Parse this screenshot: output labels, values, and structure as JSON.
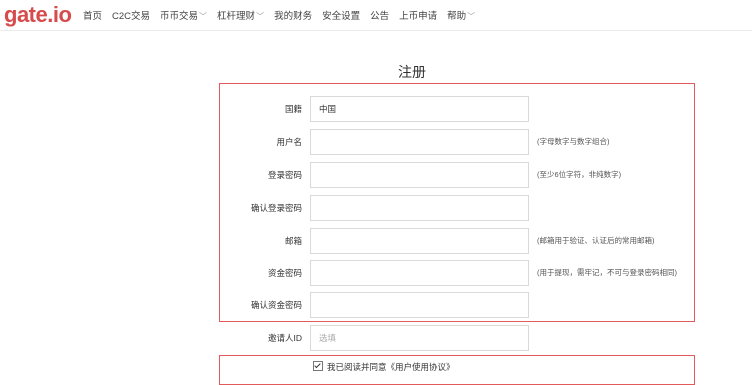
{
  "brand": {
    "gate": "gate",
    "dot": ".",
    "io": "io"
  },
  "nav": [
    {
      "label": "首页",
      "dropdown": false
    },
    {
      "label": "C2C交易",
      "dropdown": false
    },
    {
      "label": "币币交易",
      "dropdown": true
    },
    {
      "label": "杠杆理财",
      "dropdown": true
    },
    {
      "label": "我的财务",
      "dropdown": false
    },
    {
      "label": "安全设置",
      "dropdown": false
    },
    {
      "label": "公告",
      "dropdown": false
    },
    {
      "label": "上币申请",
      "dropdown": false
    },
    {
      "label": "帮助",
      "dropdown": true
    }
  ],
  "page_title": "注册",
  "form": {
    "fields": [
      {
        "label": "国籍",
        "value": "中国",
        "placeholder": "",
        "hint": ""
      },
      {
        "label": "用户名",
        "value": "",
        "placeholder": "",
        "hint": "(字母数字与数字组合)"
      },
      {
        "label": "登录密码",
        "value": "",
        "placeholder": "",
        "hint": "(至少6位字符，非纯数字)"
      },
      {
        "label": "确认登录密码",
        "value": "",
        "placeholder": "",
        "hint": ""
      },
      {
        "label": "邮箱",
        "value": "",
        "placeholder": "",
        "hint": "(邮箱用于验证、认证后的常用邮箱)"
      },
      {
        "label": "资金密码",
        "value": "",
        "placeholder": "",
        "hint": "(用于提现，需牢记，不可与登录密码相同)"
      },
      {
        "label": "确认资金密码",
        "value": "",
        "placeholder": "",
        "hint": ""
      },
      {
        "label": "邀请人ID",
        "value": "",
        "placeholder": "选填",
        "hint": ""
      }
    ],
    "agreement": "我已阅读并同意《用户使用协议》"
  },
  "colors": {
    "brand": "#d64b4b",
    "highlight_box": "#e35a5a"
  }
}
